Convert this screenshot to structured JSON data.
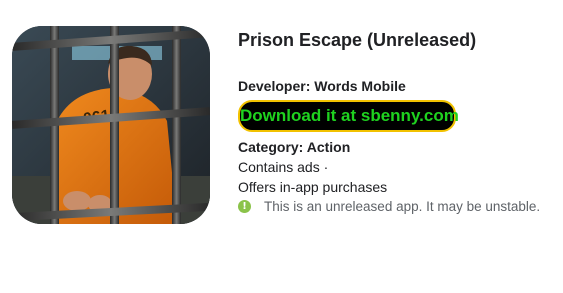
{
  "app": {
    "title": "Prison Escape (Unreleased)",
    "developer": "Developer: Words Mobile",
    "icon": "prison-escape-app-icon",
    "icon_text": "0612"
  },
  "download": {
    "label": "Download it at sbenny.com"
  },
  "meta": {
    "category": "Category: Action",
    "ads": "Contains ads ·",
    "purchases": "Offers in-app purchases"
  },
  "notice": {
    "icon": "info-icon",
    "glyph": "!",
    "text": "This is an unreleased app. It may be unstable."
  },
  "colors": {
    "button_bg": "#000000",
    "button_border": "#f2c200",
    "button_text": "#1fd21f",
    "info_icon": "#8bc34a"
  }
}
